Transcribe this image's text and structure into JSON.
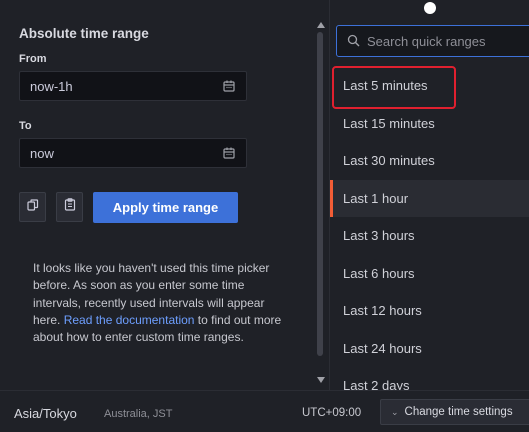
{
  "absolute": {
    "title": "Absolute time range",
    "from_label": "From",
    "from_value": "now-1h",
    "to_label": "To",
    "to_value": "now",
    "apply_label": "Apply time range",
    "help_line1": "It looks like you haven't used this time picker before. As soon as you enter some time intervals, recently used intervals will appear here.",
    "help_link": "Read the documentation",
    "help_line2": " to find out more about how to enter custom time ranges."
  },
  "quick": {
    "search_placeholder": "Search quick ranges",
    "selected_index": 3,
    "highlighted_index": 0,
    "ranges": [
      "Last 5 minutes",
      "Last 15 minutes",
      "Last 30 minutes",
      "Last 1 hour",
      "Last 3 hours",
      "Last 6 hours",
      "Last 12 hours",
      "Last 24 hours",
      "Last 2 days"
    ]
  },
  "footer": {
    "timezone": "Asia/Tokyo",
    "timezone_detail": "Australia, JST",
    "utc_offset": "UTC+09:00",
    "change_settings_label": "Change time settings"
  },
  "colors": {
    "accent_blue": "#3d71d9",
    "selected_marker": "#f35d36",
    "highlight_box": "#e0202f"
  },
  "icons": {
    "calendar": "calendar-icon",
    "copy": "copy-icon",
    "paste": "clipboard-icon",
    "search": "search-icon",
    "chevron": "chevron-down-icon"
  }
}
